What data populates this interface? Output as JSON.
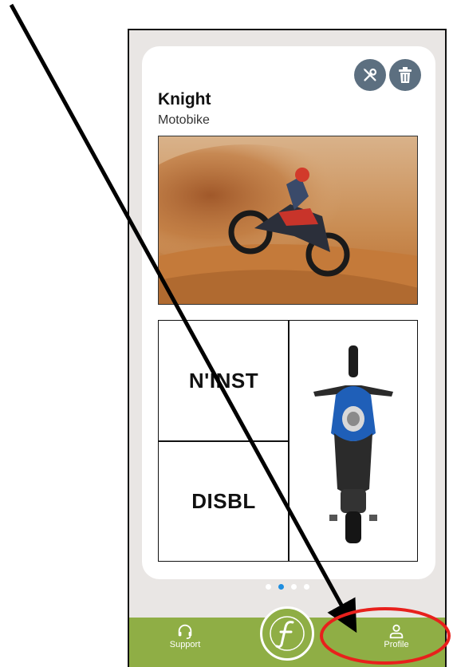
{
  "vehicle": {
    "name": "Knight",
    "type": "Motobike"
  },
  "status_cells": {
    "top": "N'INST",
    "bottom": "DISBL"
  },
  "pagination": {
    "count": 4,
    "active_index": 1
  },
  "tabbar": {
    "support_label": "Support",
    "profile_label": "Profile"
  },
  "colors": {
    "tabbar": "#8fae45",
    "icon_button": "#5c6f80",
    "active_dot": "#1e8ee0",
    "annotation_arrow": "#000000",
    "annotation_ellipse": "#e8201c"
  },
  "icons": {
    "edit": "wrench-screwdriver-icon",
    "delete": "trash-icon",
    "support": "headset-icon",
    "profile": "person-icon",
    "brand": "f-logo-icon"
  }
}
